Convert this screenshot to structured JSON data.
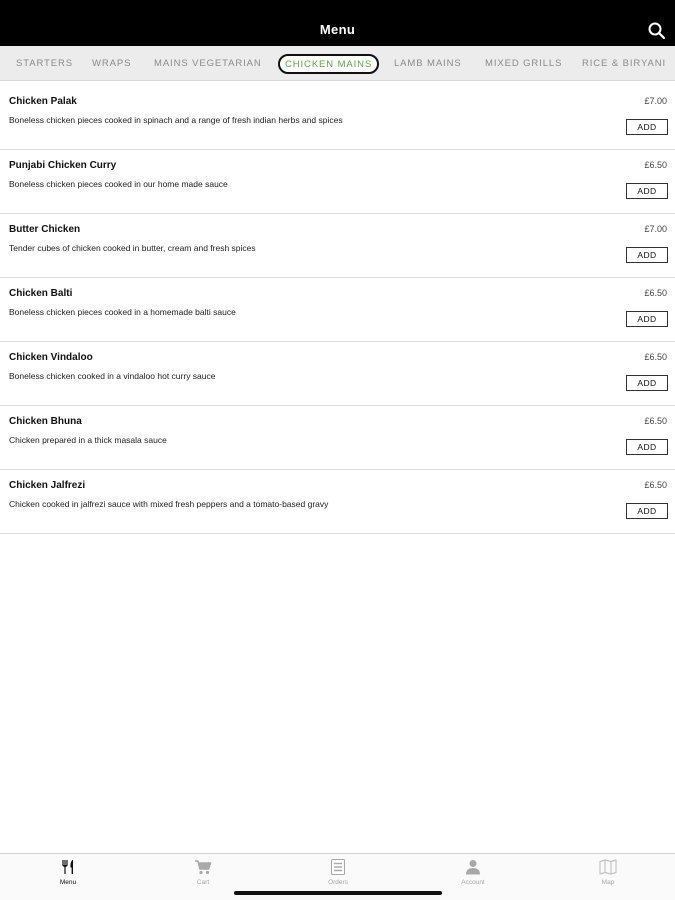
{
  "header": {
    "title": "Menu"
  },
  "categories": [
    {
      "label": "STARTERS",
      "active": false
    },
    {
      "label": "WRAPS",
      "active": false
    },
    {
      "label": "MAINS VEGETARIAN",
      "active": false
    },
    {
      "label": "CHICKEN MAINS",
      "active": true
    },
    {
      "label": "LAMB MAINS",
      "active": false
    },
    {
      "label": "MIXED GRILLS",
      "active": false
    },
    {
      "label": "RICE & BIRYANI",
      "active": false
    }
  ],
  "items": [
    {
      "name": "Chicken Palak",
      "description": "Boneless chicken pieces cooked in spinach and a range of fresh indian herbs and spices",
      "price": "£7.00",
      "add_label": "ADD"
    },
    {
      "name": "Punjabi Chicken Curry",
      "description": "Boneless chicken pieces cooked in our home made sauce",
      "price": "£6.50",
      "add_label": "ADD"
    },
    {
      "name": "Butter Chicken",
      "description": "Tender cubes of chicken cooked in butter, cream and fresh spices",
      "price": "£7.00",
      "add_label": "ADD"
    },
    {
      "name": "Chicken Balti",
      "description": "Boneless chicken pieces cooked in a homemade balti sauce",
      "price": "£6.50",
      "add_label": "ADD"
    },
    {
      "name": "Chicken Vindaloo",
      "description": "Boneless chicken cooked in a vindaloo hot curry sauce",
      "price": "£6.50",
      "add_label": "ADD"
    },
    {
      "name": "Chicken Bhuna",
      "description": "Chicken prepared in a thick masala sauce",
      "price": "£6.50",
      "add_label": "ADD"
    },
    {
      "name": "Chicken Jalfrezi",
      "description": "Chicken cooked in jalfrezi sauce with mixed fresh peppers and a tomato-based gravy",
      "price": "£6.50",
      "add_label": "ADD"
    }
  ],
  "tabs": [
    {
      "label": "Menu",
      "icon": "fork-knife-icon",
      "active": true
    },
    {
      "label": "Cart",
      "icon": "cart-icon",
      "active": false
    },
    {
      "label": "Orders",
      "icon": "orders-icon",
      "active": false
    },
    {
      "label": "Account",
      "icon": "person-icon",
      "active": false
    },
    {
      "label": "Map",
      "icon": "map-icon",
      "active": false
    }
  ],
  "colors": {
    "header_bg": "#000000",
    "active_category": "#5aa53a",
    "inactive_category": "#8a8a8a",
    "category_bar_bg": "#ececec"
  }
}
